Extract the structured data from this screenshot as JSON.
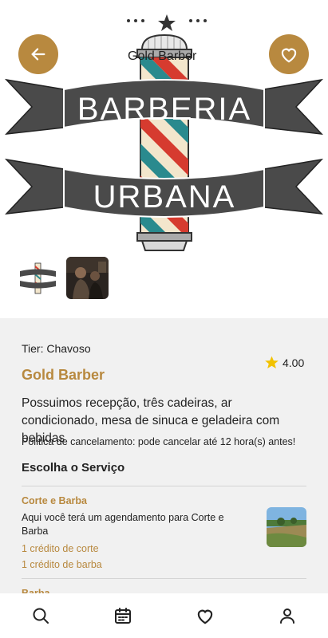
{
  "hero": {
    "title_overlay": "Gold Barber",
    "logo_line1": "BARBERIA",
    "logo_line2": "URBANA",
    "back_icon": "arrow-left-icon",
    "favorite_icon": "heart-outline-icon"
  },
  "shop": {
    "tier": "Tier: Chavoso",
    "name": "Gold Barber",
    "rating": "4.00",
    "description": "Possuimos recepção, três cadeiras, ar condicionado, mesa de sinuca e geladeira com bebidas",
    "policy": "Politica de cancelamento: pode cancelar até 12 hora(s) antes!"
  },
  "services_title": "Escolha o Serviço",
  "services": [
    {
      "name": "Corte e Barba",
      "description": "Aqui você terá um agendamento para Corte e Barba",
      "credits": [
        "1 crédito de corte",
        "1 crédito de barba"
      ]
    },
    {
      "name": "Barba"
    }
  ],
  "colors": {
    "accent": "#b8893f",
    "panel_bg": "#f1f1f1",
    "star": "#f2c200"
  },
  "nav": [
    "search-icon",
    "calendar-icon",
    "heart-icon",
    "profile-icon"
  ]
}
